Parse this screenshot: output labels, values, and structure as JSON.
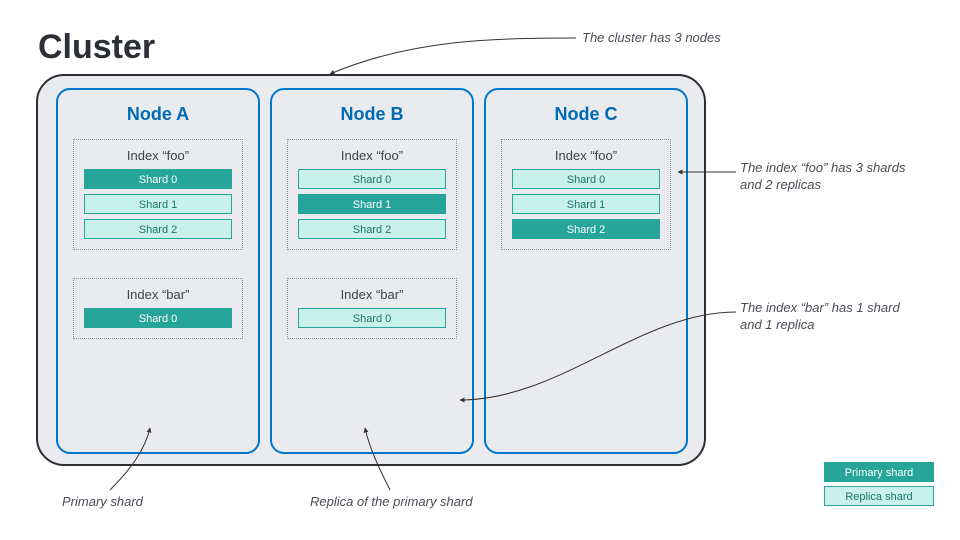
{
  "title": "Cluster",
  "nodes": {
    "a": {
      "title": "Node A"
    },
    "b": {
      "title": "Node B"
    },
    "c": {
      "title": "Node C"
    }
  },
  "index_foo": {
    "label": "Index “foo”",
    "shards": {
      "s0": "Shard 0",
      "s1": "Shard 1",
      "s2": "Shard 2"
    }
  },
  "index_bar": {
    "label": "Index “bar”",
    "shards": {
      "s0": "Shard 0"
    }
  },
  "annotations": {
    "cluster_nodes": "The cluster has 3 nodes",
    "foo_desc_1": "The index “foo” has 3 shards",
    "foo_desc_2": "and 2 replicas",
    "bar_desc_1": "The index “bar” has 1 shard",
    "bar_desc_2": "and 1 replica",
    "primary_shard": "Primary shard",
    "replica_primary": "Replica of the primary shard"
  },
  "legend": {
    "primary": "Primary shard",
    "replica": "Replica shard"
  },
  "colors": {
    "primary": "#26a69a",
    "replica": "#c9f0ea",
    "node_border": "#0077cc",
    "cluster_border": "#2e2f33"
  }
}
